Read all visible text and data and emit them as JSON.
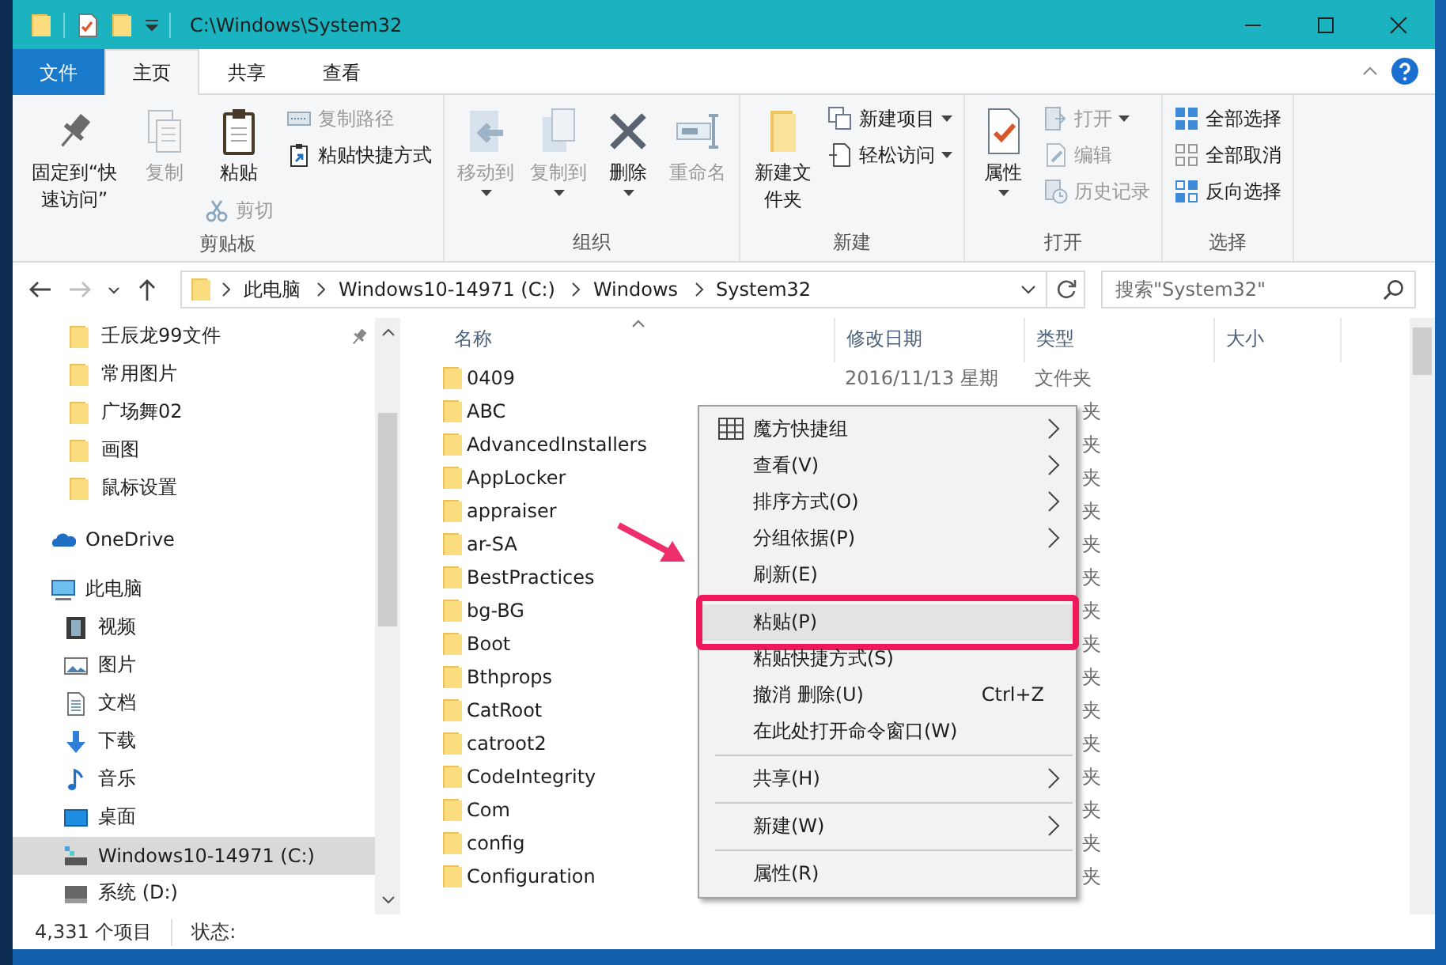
{
  "window": {
    "title": "C:\\Windows\\System32"
  },
  "ribbon": {
    "tabs": [
      {
        "label": "文件",
        "kind": "file",
        "selected": false
      },
      {
        "label": "主页",
        "kind": "tab",
        "selected": true
      },
      {
        "label": "共享",
        "kind": "tab",
        "selected": false
      },
      {
        "label": "查看",
        "kind": "tab",
        "selected": false
      }
    ],
    "groups": [
      {
        "title": "剪贴板",
        "columns": [
          [
            {
              "label": "固定到“快速访问”",
              "kind": "large",
              "disabled": false,
              "dropdown": false
            }
          ],
          [
            {
              "label": "复制",
              "kind": "large",
              "disabled": true,
              "dropdown": false
            }
          ],
          [
            {
              "label": "粘贴",
              "kind": "large",
              "disabled": false,
              "dropdown": false
            },
            {
              "label": "剪切",
              "kind": "small",
              "disabled": true,
              "dropdown": false
            }
          ],
          [
            {
              "label": "复制路径",
              "kind": "small",
              "disabled": true,
              "dropdown": false
            },
            {
              "label": "粘贴快捷方式",
              "kind": "small",
              "disabled": false,
              "dropdown": false
            }
          ]
        ]
      },
      {
        "title": "组织",
        "columns": [
          [
            {
              "label": "移动到",
              "kind": "large",
              "disabled": true,
              "dropdown": true
            }
          ],
          [
            {
              "label": "复制到",
              "kind": "large",
              "disabled": true,
              "dropdown": true
            }
          ],
          [
            {
              "label": "删除",
              "kind": "large",
              "disabled": false,
              "dropdown": true
            }
          ],
          [
            {
              "label": "重命名",
              "kind": "large",
              "disabled": true,
              "dropdown": false
            }
          ]
        ]
      },
      {
        "title": "新建",
        "columns": [
          [
            {
              "label": "新建文件夹",
              "kind": "large",
              "disabled": false,
              "dropdown": false
            }
          ],
          [
            {
              "label": "新建项目",
              "kind": "small",
              "disabled": false,
              "dropdown": true
            },
            {
              "label": "轻松访问",
              "kind": "small",
              "disabled": false,
              "dropdown": true
            }
          ]
        ]
      },
      {
        "title": "打开",
        "columns": [
          [
            {
              "label": "属性",
              "kind": "large",
              "disabled": false,
              "dropdown": true
            }
          ],
          [
            {
              "label": "打开",
              "kind": "small",
              "disabled": true,
              "dropdown": true
            },
            {
              "label": "编辑",
              "kind": "small",
              "disabled": true,
              "dropdown": false
            },
            {
              "label": "历史记录",
              "kind": "small",
              "disabled": true,
              "dropdown": false
            }
          ]
        ]
      },
      {
        "title": "选择",
        "columns": [
          [
            {
              "label": "全部选择",
              "kind": "small",
              "disabled": false,
              "dropdown": false
            },
            {
              "label": "全部取消",
              "kind": "small",
              "disabled": false,
              "dropdown": false
            },
            {
              "label": "反向选择",
              "kind": "small",
              "disabled": false,
              "dropdown": false
            }
          ]
        ]
      }
    ]
  },
  "navigation": {
    "buttons": [
      {
        "kind": "back",
        "disabled": false
      },
      {
        "kind": "forward",
        "disabled": true
      },
      {
        "kind": "recent",
        "disabled": false
      },
      {
        "kind": "up",
        "disabled": false
      }
    ],
    "address": {
      "segments": [
        "此电脑",
        "Windows10-14971 (C:)",
        "Windows",
        "System32"
      ]
    },
    "search": {
      "placeholder": "搜索\"System32\""
    }
  },
  "sidebar": {
    "items": [
      {
        "label": "壬辰龙99文件",
        "kind": "folder",
        "pinned": true,
        "selected": false
      },
      {
        "label": "常用图片",
        "kind": "folder",
        "pinned": false,
        "selected": false
      },
      {
        "label": "广场舞02",
        "kind": "folder",
        "pinned": false,
        "selected": false
      },
      {
        "label": "画图",
        "kind": "folder",
        "pinned": false,
        "selected": false
      },
      {
        "label": "鼠标设置",
        "kind": "folder",
        "pinned": false,
        "selected": false
      },
      {
        "label": "OneDrive",
        "kind": "cloud",
        "pinned": false,
        "selected": false
      },
      {
        "label": "此电脑",
        "kind": "pc",
        "pinned": false,
        "selected": false,
        "children": [
          {
            "label": "视频",
            "kind": "videos",
            "pinned": false,
            "selected": false
          },
          {
            "label": "图片",
            "kind": "pictures",
            "pinned": false,
            "selected": false
          },
          {
            "label": "文档",
            "kind": "documents",
            "pinned": false,
            "selected": false
          },
          {
            "label": "下载",
            "kind": "downloads",
            "pinned": false,
            "selected": false
          },
          {
            "label": "音乐",
            "kind": "music",
            "pinned": false,
            "selected": false
          },
          {
            "label": "桌面",
            "kind": "desktop",
            "pinned": false,
            "selected": false
          },
          {
            "label": "Windows10-14971 (C:)",
            "kind": "system-drive",
            "pinned": false,
            "selected": true
          },
          {
            "label": "系统 (D:)",
            "kind": "drive",
            "pinned": false,
            "selected": false
          }
        ]
      }
    ]
  },
  "file_list": {
    "columns": [
      {
        "label": "名称",
        "sorted": true
      },
      {
        "label": "修改日期",
        "sorted": false
      },
      {
        "label": "类型",
        "sorted": false
      },
      {
        "label": "大小",
        "sorted": false
      }
    ],
    "rows": [
      {
        "name": "0409",
        "date": "2016/11/13 星期",
        "type": "文件夹"
      },
      {
        "name": "ABC",
        "type": "夹"
      },
      {
        "name": "AdvancedInstallers",
        "type": "夹"
      },
      {
        "name": "AppLocker",
        "type": "夹"
      },
      {
        "name": "appraiser",
        "type": "夹"
      },
      {
        "name": "ar-SA",
        "type": "夹"
      },
      {
        "name": "BestPractices",
        "type": "夹"
      },
      {
        "name": "bg-BG",
        "type": "夹"
      },
      {
        "name": "Boot",
        "type": "夹"
      },
      {
        "name": "Bthprops",
        "type": "夹"
      },
      {
        "name": "CatRoot",
        "type": "夹"
      },
      {
        "name": "catroot2",
        "type": "夹"
      },
      {
        "name": "CodeIntegrity",
        "type": "夹"
      },
      {
        "name": "Com",
        "type": "夹"
      },
      {
        "name": "config",
        "type": "夹"
      },
      {
        "name": "Configuration",
        "type": "夹"
      }
    ]
  },
  "context_menu": {
    "items": [
      {
        "kind": "extension",
        "label": "魔方快捷组",
        "submenu": true,
        "highlighted": false,
        "annotated": false
      },
      {
        "kind": "item",
        "label": "查看(V)",
        "submenu": true,
        "highlighted": false,
        "annotated": false
      },
      {
        "kind": "item",
        "label": "排序方式(O)",
        "submenu": true,
        "highlighted": false,
        "annotated": false
      },
      {
        "kind": "item",
        "label": "分组依据(P)",
        "submenu": true,
        "highlighted": false,
        "annotated": false
      },
      {
        "kind": "item",
        "label": "刷新(E)",
        "submenu": false,
        "highlighted": false,
        "annotated": false
      },
      {
        "kind": "separator"
      },
      {
        "kind": "item",
        "label": "粘贴(P)",
        "submenu": false,
        "highlighted": true,
        "annotated": true
      },
      {
        "kind": "item",
        "label": "粘贴快捷方式(S)",
        "submenu": false,
        "highlighted": false,
        "annotated": false
      },
      {
        "kind": "item",
        "label": "撤消 删除(U)",
        "shortcut": "Ctrl+Z",
        "submenu": false,
        "highlighted": false,
        "annotated": false
      },
      {
        "kind": "item",
        "label": "在此处打开命令窗口(W)",
        "submenu": false,
        "highlighted": false,
        "annotated": false
      },
      {
        "kind": "separator"
      },
      {
        "kind": "item",
        "label": "共享(H)",
        "submenu": true,
        "highlighted": false,
        "annotated": false
      },
      {
        "kind": "separator"
      },
      {
        "kind": "item",
        "label": "新建(W)",
        "submenu": true,
        "highlighted": false,
        "annotated": false
      },
      {
        "kind": "separator"
      },
      {
        "kind": "item",
        "label": "属性(R)",
        "submenu": false,
        "highlighted": false,
        "annotated": false
      }
    ]
  },
  "status_bar": {
    "item_count": "4,331 个项目",
    "status": "状态:"
  }
}
